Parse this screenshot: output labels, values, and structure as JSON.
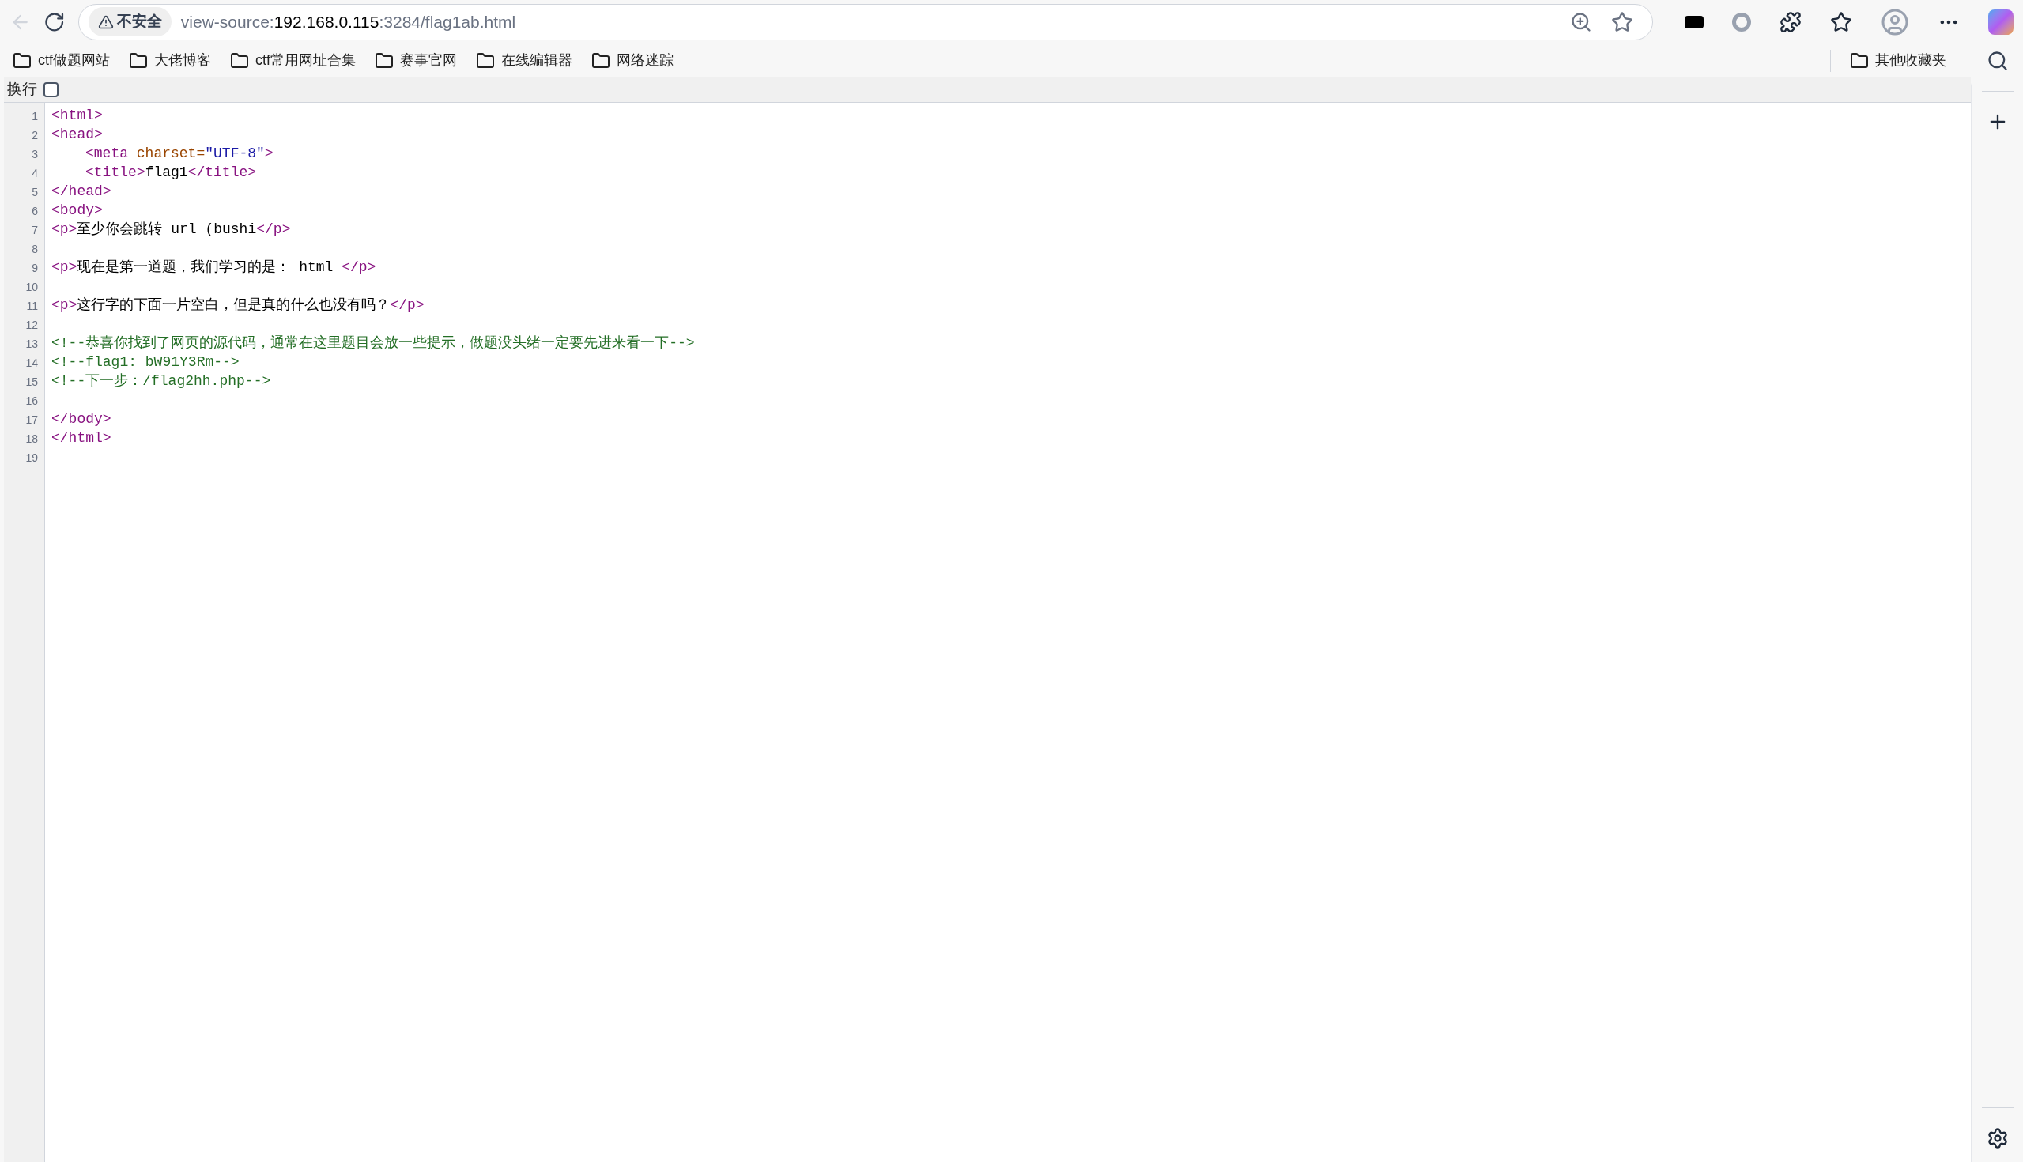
{
  "toolbar": {
    "security_label": "不安全",
    "url": {
      "scheme": "view-source:",
      "host": "192.168.0.115",
      "path": ":3284/flag1ab.html"
    }
  },
  "bookmarks": [
    {
      "label": "ctf做题网站"
    },
    {
      "label": "大佬博客"
    },
    {
      "label": "ctf常用网址合集"
    },
    {
      "label": "赛事官网"
    },
    {
      "label": "在线编辑器"
    },
    {
      "label": "网络迷踪"
    }
  ],
  "other_bookmarks": "其他收藏夹",
  "wrap_toggle": {
    "label": "换行",
    "checked": false
  },
  "lines": [
    {
      "number": "1",
      "tokens": [
        {
          "kind": "tag",
          "text": "<html>"
        }
      ]
    },
    {
      "number": "2",
      "tokens": [
        {
          "kind": "tag",
          "text": "<head>"
        }
      ]
    },
    {
      "number": "3",
      "indented": true,
      "tokens": [
        {
          "kind": "tag",
          "text": "<meta "
        },
        {
          "kind": "attr",
          "text": "charset="
        },
        {
          "kind": "value",
          "text": "\"UTF-8\""
        },
        {
          "kind": "tag",
          "text": ">"
        }
      ]
    },
    {
      "number": "4",
      "indented": true,
      "tokens": [
        {
          "kind": "tag",
          "text": "<title>"
        },
        {
          "kind": "text",
          "text": "flag1"
        },
        {
          "kind": "tag",
          "text": "</title>"
        }
      ]
    },
    {
      "number": "5",
      "tokens": [
        {
          "kind": "tag",
          "text": "</head>"
        }
      ]
    },
    {
      "number": "6",
      "tokens": [
        {
          "kind": "tag",
          "text": "<body>"
        }
      ]
    },
    {
      "number": "7",
      "tokens": [
        {
          "kind": "tag",
          "text": "<p>"
        },
        {
          "kind": "text",
          "text": "至少你会跳转 url (bushi"
        },
        {
          "kind": "tag",
          "text": "</p>"
        }
      ]
    },
    {
      "number": "8"
    },
    {
      "number": "9",
      "tokens": [
        {
          "kind": "tag",
          "text": "<p>"
        },
        {
          "kind": "text",
          "text": "现在是第一道题，我们学习的是： html "
        },
        {
          "kind": "tag",
          "text": "</p>"
        }
      ]
    },
    {
      "number": "10"
    },
    {
      "number": "11",
      "tokens": [
        {
          "kind": "tag",
          "text": "<p>"
        },
        {
          "kind": "text",
          "text": "这行字的下面一片空白，但是真的什么也没有吗？"
        },
        {
          "kind": "tag",
          "text": "</p>"
        }
      ]
    },
    {
      "number": "12"
    },
    {
      "number": "13",
      "tokens": [
        {
          "kind": "comment",
          "text": "<!--恭喜你找到了网页的源代码，通常在这里题目会放一些提示，做题没头绪一定要先进来看一下-->"
        }
      ]
    },
    {
      "number": "14",
      "tokens": [
        {
          "kind": "comment",
          "text": "<!--flag1: bW91Y3Rm-->"
        }
      ]
    },
    {
      "number": "15",
      "tokens": [
        {
          "kind": "comment",
          "text": "<!--下一步：/flag2hh.php-->"
        }
      ]
    },
    {
      "number": "16"
    },
    {
      "number": "17",
      "tokens": [
        {
          "kind": "tag",
          "text": "</body>"
        }
      ]
    },
    {
      "number": "18",
      "tokens": [
        {
          "kind": "tag",
          "text": "</html>"
        }
      ]
    },
    {
      "number": "19"
    }
  ]
}
